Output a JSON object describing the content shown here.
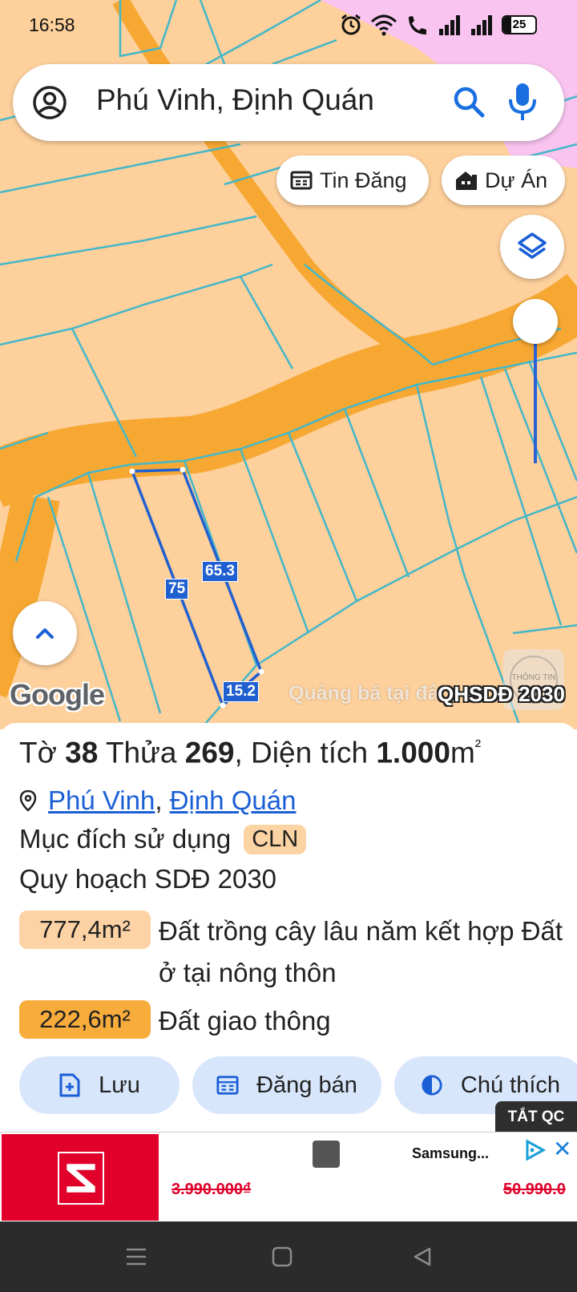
{
  "status_bar": {
    "time": "16:58",
    "battery": "25",
    "battery_level": 0.25
  },
  "search": {
    "query": "Phú Vinh, Định Quán"
  },
  "chips": {
    "tin_dang": "Tin Đăng",
    "du_an": "Dự Án"
  },
  "map": {
    "colors": {
      "land": "#fdd09c",
      "road": "#f7a832",
      "parcel_line": "#43b7c9",
      "selected_parcel": "#2160cf",
      "zone_pink": "#f9c4f0"
    },
    "dimension_labels": {
      "side_left": "75",
      "side_right": "65.3",
      "side_bottom": "15.2"
    },
    "google_logo": "Google",
    "promo_text": "Quảng bá tại đây",
    "layer_label": "QHSDĐ 2030",
    "stamp_text": "THÔNG TIN"
  },
  "parcel": {
    "sheet_label": "Tờ",
    "sheet_no": "38",
    "lot_label": "Thửa",
    "lot_no": "269",
    "area_label": "Diện tích",
    "area_value": "1.000",
    "area_unit": "m",
    "area_sup": "²",
    "ward": "Phú Vinh",
    "district": "Định Quán",
    "purpose_label": "Mục đích sử dụng",
    "purpose_code": "CLN",
    "plan_label": "Quy hoạch SDĐ 2030",
    "planning": [
      {
        "area": "777,4m²",
        "description": "Đất trồng cây lâu năm kết hợp Đất ở tại nông thôn",
        "color": "#fdd3a5"
      },
      {
        "area": "222,6m²",
        "description": "Đất giao thông",
        "color": "#f7ac3c"
      }
    ]
  },
  "actions": {
    "save": "Lưu",
    "sell": "Đăng bán",
    "legend": "Chú thích"
  },
  "ad": {
    "close_tag": "TẮT QC",
    "product_name": "Samsung...",
    "price_old_1": "3.990.000₫",
    "price_old_2": "50.990.0"
  }
}
